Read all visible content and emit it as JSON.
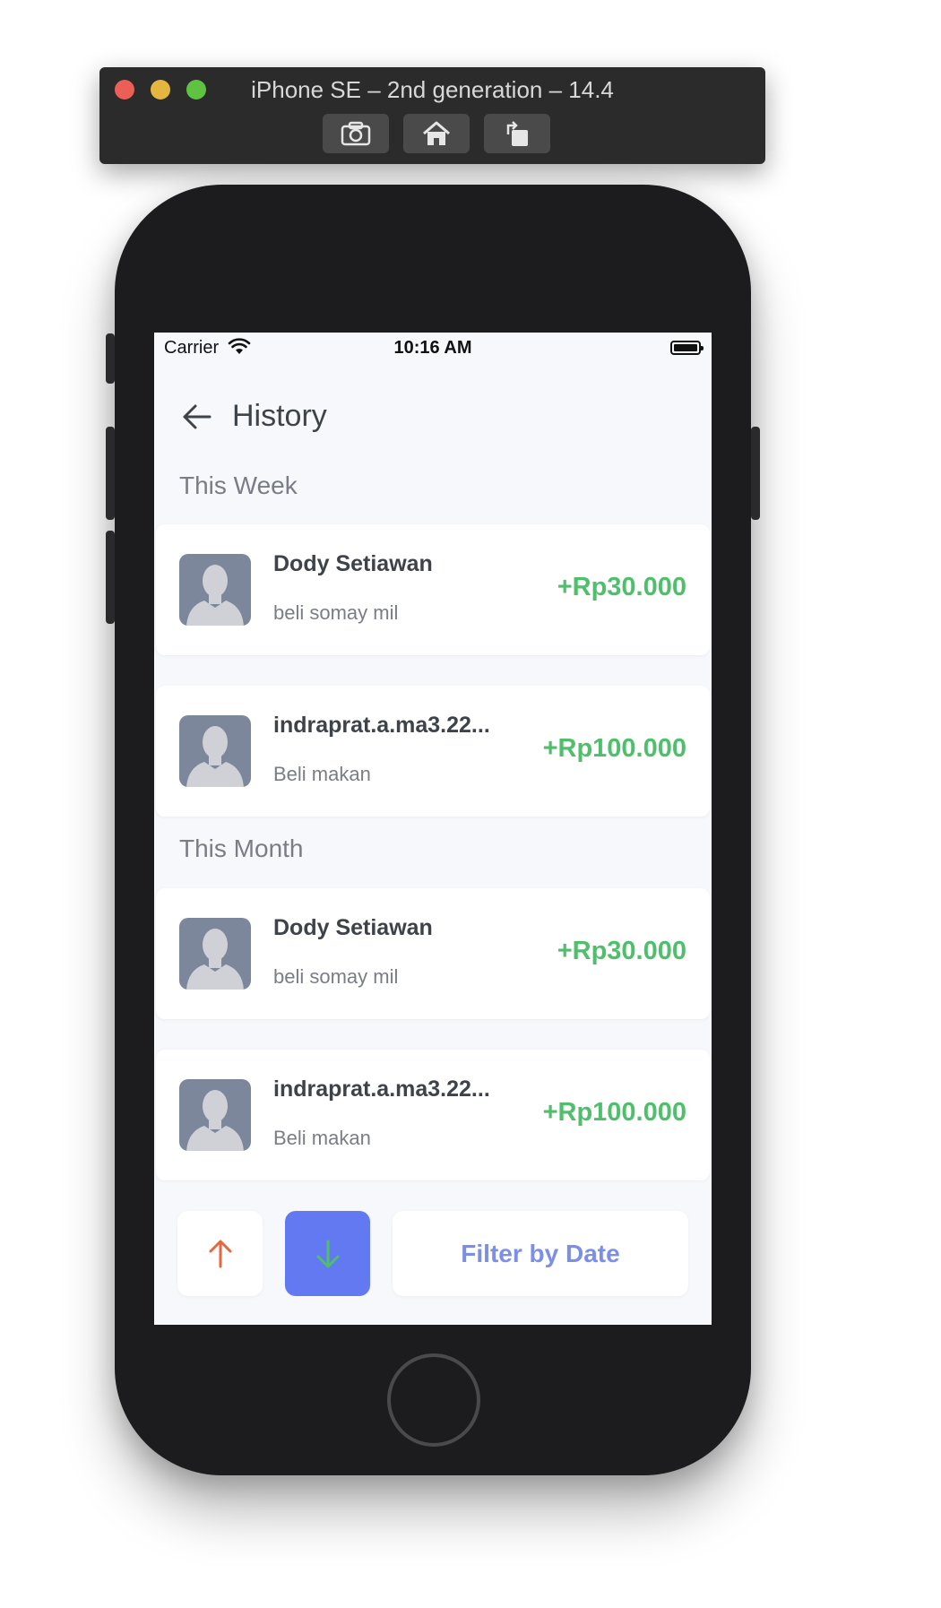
{
  "simulator": {
    "title": "iPhone SE – 2nd generation – 14.4",
    "buttons": [
      "screenshot-icon",
      "home-icon",
      "rotate-icon"
    ]
  },
  "status_bar": {
    "carrier": "Carrier",
    "time": "10:16 AM"
  },
  "header": {
    "title": "History"
  },
  "sections": [
    {
      "title": "This Week",
      "transactions": [
        {
          "name": "Dody Setiawan",
          "note": "beli somay mil",
          "amount": "+Rp30.000"
        },
        {
          "name": "indraprat.a.ma3.22...",
          "note": "Beli makan",
          "amount": "+Rp100.000"
        }
      ]
    },
    {
      "title": "This Month",
      "transactions": [
        {
          "name": "Dody Setiawan",
          "note": "beli somay mil",
          "amount": "+Rp30.000"
        },
        {
          "name": "indraprat.a.ma3.22...",
          "note": "Beli makan",
          "amount": "+Rp100.000"
        }
      ]
    }
  ],
  "filter": {
    "label": "Filter by Date",
    "sort_up_icon": "arrow-up-icon",
    "sort_down_icon": "arrow-down-icon",
    "selected": "down"
  },
  "colors": {
    "accent": "#6379f2",
    "income": "#4fbf6c",
    "outgoing": "#e4673f",
    "background": "#f6f8fc"
  }
}
